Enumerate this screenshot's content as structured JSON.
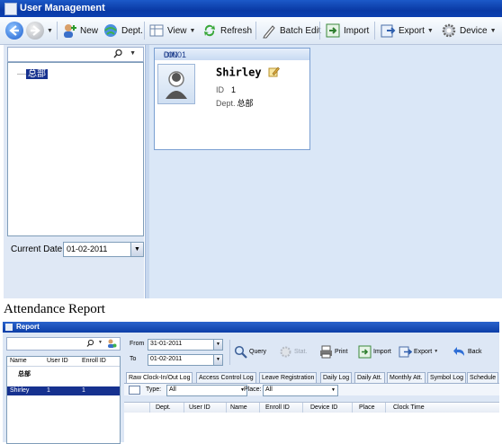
{
  "window1": {
    "title": "User Management",
    "toolbar": {
      "new_label": "New",
      "dept_label": "Dept.",
      "view_label": "View",
      "refresh_label": "Refresh",
      "batch_edit_label": "Batch Edit",
      "import_label": "Import",
      "export_label": "Export",
      "device_label": "Device"
    },
    "tree": {
      "root_label": "总部"
    },
    "current_date": {
      "label": "Current Date",
      "value": "01-02-2011"
    },
    "user_card": {
      "din_label": "DIN",
      "din_value": "00001",
      "name": "Shirley",
      "id_label": "ID",
      "id_value": "1",
      "dept_label": "Dept.",
      "dept_value": "总部"
    }
  },
  "heading": "Attendance Report",
  "window2": {
    "title": "Report",
    "left_grid": {
      "headers": [
        "Name",
        "User ID",
        "Enroll ID"
      ],
      "group_row": "总部",
      "rows": [
        {
          "name": "Shirley",
          "user_id": "1",
          "enroll_id": "1"
        }
      ]
    },
    "from_label": "From",
    "from_value": "31-01-2011",
    "to_label": "To",
    "to_value": "01-02-2011",
    "toolbar": {
      "query_label": "Query",
      "stat_label": "Stat.",
      "print_label": "Print",
      "import_label": "Import",
      "export_label": "Export",
      "back_label": "Back"
    },
    "tabs": [
      "Raw Clock-In/Out Log",
      "Access Control Log",
      "Leave Registration",
      "Daily Log",
      "Daily Att.",
      "Monthly Att.",
      "Symbol Log",
      "Schedule"
    ],
    "filter": {
      "type_label": "Type:",
      "type_value": "All",
      "place_label": "Place:",
      "place_value": "All"
    },
    "grid_headers": [
      "Dept.",
      "User ID",
      "Name",
      "Enroll ID",
      "Device ID",
      "Place",
      "Clock Time"
    ]
  },
  "colors": {
    "titlebar": "#0a3aa5",
    "selection": "#16318f",
    "pane_bg": "#dae7f7"
  }
}
